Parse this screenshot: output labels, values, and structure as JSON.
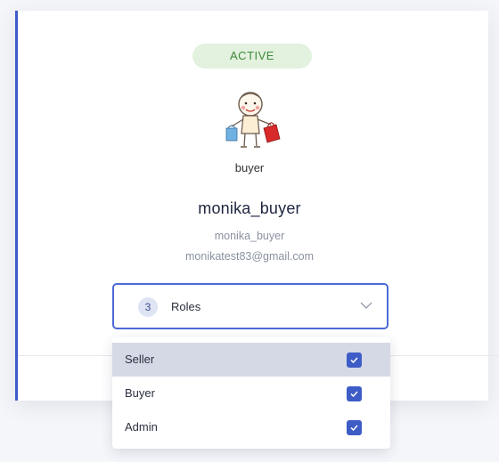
{
  "profile": {
    "status": "ACTIVE",
    "role_caption": "buyer",
    "display_name": "monika_buyer",
    "username": "monika_buyer",
    "email": "monikatest83@gmail.com"
  },
  "roles_select": {
    "count": "3",
    "label": "Roles",
    "options": [
      {
        "label": "Seller",
        "checked": true,
        "highlighted": true
      },
      {
        "label": "Buyer",
        "checked": true,
        "highlighted": false
      },
      {
        "label": "Admin",
        "checked": true,
        "highlighted": false
      }
    ]
  },
  "colors": {
    "accent": "#3d5bc9",
    "status_bg": "#e3f1df",
    "status_text": "#3f8a3b",
    "checkbox": "#3e5cc6"
  },
  "icons": [
    "shopper-avatar-illustration",
    "chevron-down-icon",
    "checkmark-icon"
  ]
}
